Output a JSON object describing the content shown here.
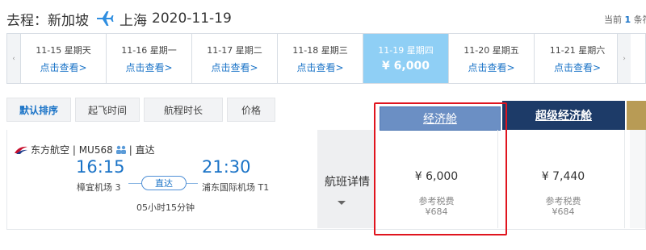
{
  "route": {
    "prefix": "去程：",
    "origin": "新加坡",
    "destination": "上海",
    "date": "2020-11-19",
    "plane_icon": "plane-icon"
  },
  "page_indicator": {
    "prefix": "当前",
    "current": "1",
    "suffix": "条符"
  },
  "date_strip": {
    "days": [
      {
        "date": "11-15 星期天",
        "action": "点击查看>"
      },
      {
        "date": "11-16 星期一",
        "action": "点击查看>"
      },
      {
        "date": "11-17 星期二",
        "action": "点击查看>"
      },
      {
        "date": "11-18 星期三",
        "action": "点击查看>"
      },
      {
        "date": "11-19 星期四",
        "action": "¥ 6,000",
        "selected": true
      },
      {
        "date": "11-20 星期五",
        "action": "点击查看>"
      },
      {
        "date": "11-21 星期六",
        "action": "点击查看>"
      }
    ],
    "left_arrow": "‹",
    "right_arrow": "›"
  },
  "sort_tabs": [
    {
      "label": "默认排序",
      "active": true
    },
    {
      "label": "起飞时间"
    },
    {
      "label": "航程时长"
    },
    {
      "label": "价格"
    }
  ],
  "cabins": {
    "economy": "经济舱",
    "super_economy": "超级经济舱"
  },
  "flight": {
    "airline": "东方航空",
    "flight_no": "MU568",
    "type": "直达",
    "dep_time": "16:15",
    "arr_time": "21:30",
    "dep_airport": "樟宜机场 3",
    "arr_airport": "浦东国际机场 T1",
    "direct_label": "直达",
    "duration": "05小时15分钟",
    "detail_label": "航班详情",
    "economy": {
      "price": "¥ 6,000",
      "tax_label": "参考税费",
      "tax": "¥684"
    },
    "super_economy": {
      "price": "¥ 7,440",
      "tax_label": "参考税费",
      "tax": "¥684"
    }
  },
  "colors": {
    "accent": "#1a73c7",
    "selected_day": "#8fcff5",
    "economy_header": "#6b8fc4",
    "super_economy_header": "#1d3b68",
    "highlight": "#e0141e"
  }
}
